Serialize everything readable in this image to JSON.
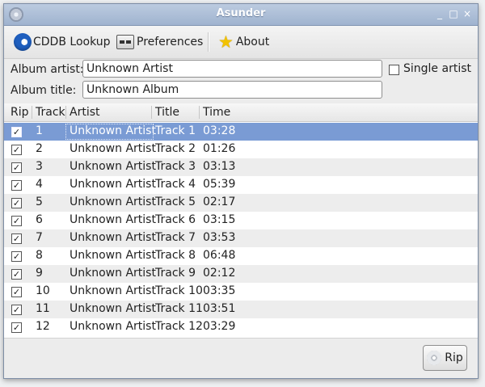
{
  "window": {
    "title": "Asunder",
    "minimize": "_",
    "maximize": "□",
    "close": "×"
  },
  "toolbar": {
    "cddb_label": "CDDB Lookup",
    "preferences_label": "Preferences",
    "about_label": "About"
  },
  "form": {
    "album_artist_label": "Album artist:",
    "album_artist_value": "Unknown Artist",
    "album_title_label": "Album title:",
    "album_title_value": "Unknown Album",
    "single_artist_label": "Single artist"
  },
  "table": {
    "columns": [
      "Rip",
      "Track",
      "Artist",
      "Title",
      "Time"
    ],
    "rows": [
      {
        "rip": "✓",
        "track": "1",
        "artist": "Unknown Artist",
        "title": "Track 1",
        "time": "03:28"
      },
      {
        "rip": "✓",
        "track": "2",
        "artist": "Unknown Artist",
        "title": "Track 2",
        "time": "01:26"
      },
      {
        "rip": "✓",
        "track": "3",
        "artist": "Unknown Artist",
        "title": "Track 3",
        "time": "03:13"
      },
      {
        "rip": "✓",
        "track": "4",
        "artist": "Unknown Artist",
        "title": "Track 4",
        "time": "05:39"
      },
      {
        "rip": "✓",
        "track": "5",
        "artist": "Unknown Artist",
        "title": "Track 5",
        "time": "02:17"
      },
      {
        "rip": "✓",
        "track": "6",
        "artist": "Unknown Artist",
        "title": "Track 6",
        "time": "03:15"
      },
      {
        "rip": "✓",
        "track": "7",
        "artist": "Unknown Artist",
        "title": "Track 7",
        "time": "03:53"
      },
      {
        "rip": "✓",
        "track": "8",
        "artist": "Unknown Artist",
        "title": "Track 8",
        "time": "06:48"
      },
      {
        "rip": "✓",
        "track": "9",
        "artist": "Unknown Artist",
        "title": "Track 9",
        "time": "02:12"
      },
      {
        "rip": "✓",
        "track": "10",
        "artist": "Unknown Artist",
        "title": "Track 10",
        "time": "03:35"
      },
      {
        "rip": "✓",
        "track": "11",
        "artist": "Unknown Artist",
        "title": "Track 11",
        "time": "03:51"
      },
      {
        "rip": "✓",
        "track": "12",
        "artist": "Unknown Artist",
        "title": "Track 12",
        "time": "03:29"
      }
    ]
  },
  "actions": {
    "rip_label": "Rip"
  },
  "colors": {
    "selection": "#7a9bd4",
    "titlebar": "#a9bbd6"
  },
  "icons": {
    "cddb": "cddb-refresh-icon",
    "preferences": "preferences-icon",
    "about": "star-icon",
    "rip": "disc-icon",
    "app": "asunder-app-icon"
  }
}
